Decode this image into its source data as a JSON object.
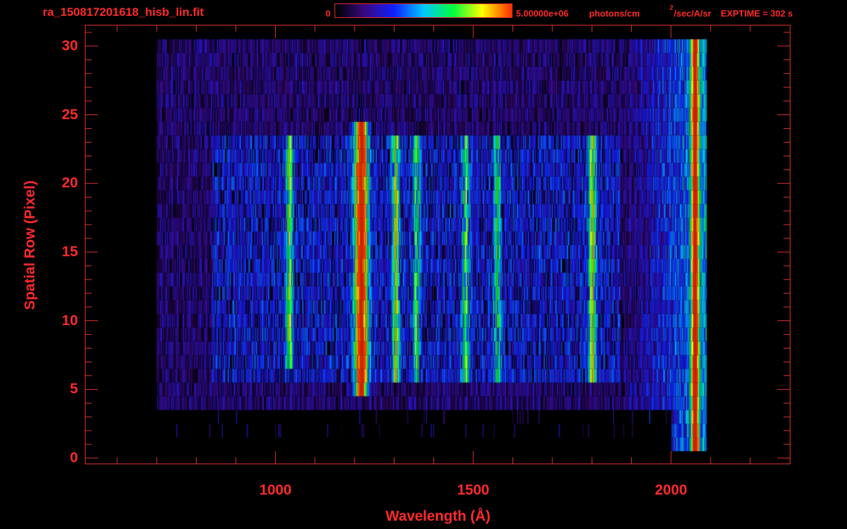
{
  "header": {
    "file_title": "ra_150817201618_hisb_lin.fit",
    "colorbar_min_label": "0",
    "colorbar_max_label": "5.00000e+06",
    "colorbar_unit_a": "photons/cm",
    "colorbar_unit_sup": "2",
    "colorbar_unit_b": "/sec/A/sr",
    "exptime_label": "EXPTIME = 302 s"
  },
  "colors": {
    "text": "#ff2a2a",
    "frame": "#e03030",
    "background": "#000000"
  },
  "chart_data": {
    "type": "heatmap",
    "title": "ra_150817201618_hisb_lin.fit",
    "xlabel": "Wavelength (Å)",
    "ylabel": "Spatial Row (Pixel)",
    "xlim": [
      520,
      2300
    ],
    "ylim": [
      -0.4,
      31.5
    ],
    "x_ticks": [
      1000,
      1500,
      2000
    ],
    "x_tick_labels": [
      "1000",
      "1500",
      "2000"
    ],
    "y_ticks": [
      0,
      5,
      10,
      15,
      20,
      25,
      30
    ],
    "y_tick_labels": [
      "0",
      "5",
      "10",
      "15",
      "20",
      "25",
      "30"
    ],
    "colorbar": {
      "min": 0,
      "max": 5000000,
      "min_label": "0",
      "max_label": "5.00000e+06",
      "colormap": "rainbow",
      "stops": [
        "#000000",
        "#3a0a82",
        "#1020ff",
        "#00c8ff",
        "#00ff40",
        "#ffff00",
        "#ff3000"
      ]
    },
    "grid": false,
    "detector_region": {
      "x_range": [
        700,
        2090
      ],
      "y_range": [
        4,
        30
      ]
    },
    "slit_region": {
      "x_range": [
        840,
        1870
      ],
      "y_range": [
        6,
        23
      ]
    },
    "emission_lines": [
      {
        "wavelength": 1216,
        "intensity": 0.95,
        "y_range": [
          5,
          24
        ]
      },
      {
        "wavelength": 1035,
        "intensity": 0.45,
        "y_range": [
          7,
          23
        ]
      },
      {
        "wavelength": 1304,
        "intensity": 0.5,
        "y_range": [
          6,
          23
        ]
      },
      {
        "wavelength": 1356,
        "intensity": 0.4,
        "y_range": [
          6,
          23
        ]
      },
      {
        "wavelength": 1480,
        "intensity": 0.4,
        "y_range": [
          6,
          23
        ]
      },
      {
        "wavelength": 1560,
        "intensity": 0.35,
        "y_range": [
          6,
          23
        ]
      },
      {
        "wavelength": 1800,
        "intensity": 0.55,
        "y_range": [
          6,
          23
        ]
      },
      {
        "wavelength": 2060,
        "intensity": 0.85,
        "y_range": [
          1,
          30
        ]
      }
    ]
  }
}
